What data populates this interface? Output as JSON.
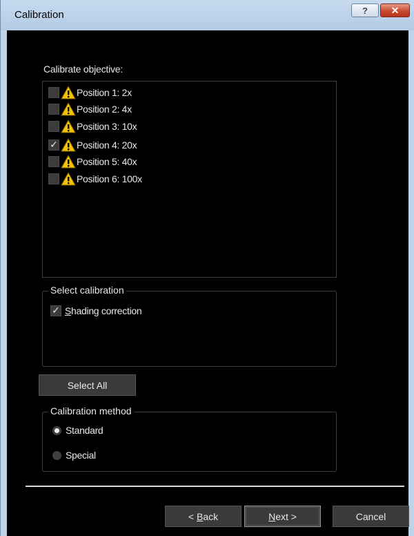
{
  "window": {
    "title": "Calibration",
    "help_glyph": "?",
    "close_glyph": "✕"
  },
  "objectives": {
    "label": "Calibrate objective:",
    "items": [
      {
        "label": "Position 1: 2x",
        "checked": false,
        "check_glyph": ""
      },
      {
        "label": "Position 2: 4x",
        "checked": false,
        "check_glyph": ""
      },
      {
        "label": "Position 3: 10x",
        "checked": false,
        "check_glyph": ""
      },
      {
        "label": "Position 4: 20x",
        "checked": true,
        "check_glyph": "✓"
      },
      {
        "label": "Position 5: 40x",
        "checked": false,
        "check_glyph": ""
      },
      {
        "label": "Position 6: 100x",
        "checked": false,
        "check_glyph": ""
      }
    ],
    "item_icon": "warning-icon"
  },
  "select_calibration": {
    "title": "Select calibration",
    "shading": {
      "label_accel": "S",
      "label_rest": "hading correction",
      "checked": true,
      "check_glyph": "✓"
    }
  },
  "select_all_label": "Select All",
  "calibration_method": {
    "title": "Calibration method",
    "options": [
      {
        "label": "Standard",
        "selected": true
      },
      {
        "label": "Special",
        "selected": false
      }
    ]
  },
  "buttons": {
    "back_prefix": "< ",
    "back_accel": "B",
    "back_rest": "ack",
    "next_accel": "N",
    "next_rest": "ext >",
    "cancel": "Cancel"
  },
  "colors": {
    "background": "#000000",
    "frame": "#bcd3ea",
    "text": "#e8e8e8",
    "warning_yellow": "#f5c400"
  }
}
